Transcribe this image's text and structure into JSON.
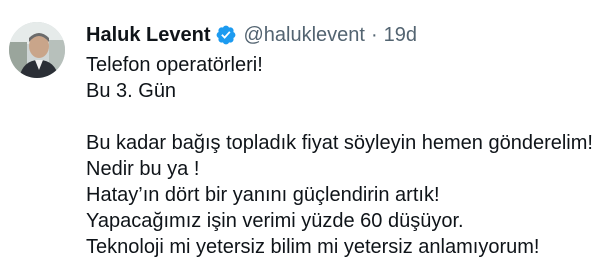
{
  "tweet": {
    "author": {
      "display_name": "Haluk Levent",
      "handle": "@haluklevent",
      "verified": true,
      "avatar_icon": "profile-photo"
    },
    "separator": "·",
    "timestamp": "19d",
    "lines": [
      "Telefon operatörleri!",
      "Bu 3. Gün",
      "",
      "Bu kadar bağış topladık fiyat söyleyin hemen gönderelim!",
      "Nedir bu ya !",
      "Hatay’ın dört bir yanını güçlendirin artık!",
      "Yapacağımız işin verimi yüzde 60 düşüyor.",
      "Teknoloji mi yetersiz bilim mi yetersiz anlamıyorum!"
    ]
  },
  "colors": {
    "text_primary": "#0f1419",
    "text_secondary": "#536471",
    "verified_badge": "#1d9bf0",
    "background": "#ffffff"
  }
}
